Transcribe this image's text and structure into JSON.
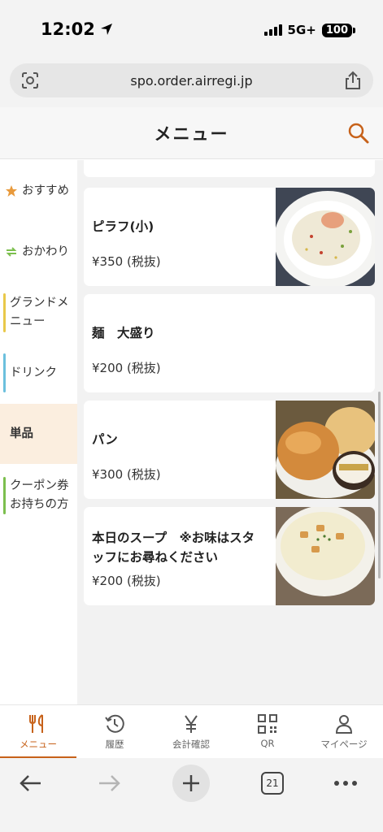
{
  "status": {
    "time": "12:02",
    "network": "5G+",
    "battery": "100"
  },
  "browser": {
    "url": "spo.order.airregi.jp",
    "tab_count": "21"
  },
  "header": {
    "title": "メニュー"
  },
  "sidebar": {
    "items": [
      {
        "label": "おすすめ",
        "icon": "star-icon"
      },
      {
        "label": "おかわり",
        "icon": "refresh-icon"
      },
      {
        "label": "グランドメニュー",
        "accent": "#e9c84a"
      },
      {
        "label": "ドリンク",
        "accent": "#6cc0dd"
      },
      {
        "label": "単品",
        "active": true
      },
      {
        "label": "クーポン券お持ちの方",
        "accent": "#7cbf4e"
      }
    ]
  },
  "menu_items": [
    {
      "name": "ピラフ(小)",
      "price": "¥350 (税抜)",
      "image": "pilaf-photo"
    },
    {
      "name": "麺　大盛り",
      "price": "¥200 (税抜)"
    },
    {
      "name": "パン",
      "price": "¥300 (税抜)",
      "image": "bread-butter-photo"
    },
    {
      "name": "本日のスープ　※お味はスタッフにお尋ねください",
      "price": "¥200 (税抜)",
      "image": "soup-photo"
    }
  ],
  "tabs": [
    {
      "label": "メニュー",
      "icon": "fork-knife-icon",
      "active": true
    },
    {
      "label": "履歴",
      "icon": "history-icon"
    },
    {
      "label": "会計確認",
      "icon": "yen-icon"
    },
    {
      "label": "QR",
      "icon": "qr-code-icon"
    },
    {
      "label": "マイページ",
      "icon": "person-icon"
    }
  ],
  "colors": {
    "accent": "#c7621a",
    "active_category_bg": "#fbeedf"
  }
}
